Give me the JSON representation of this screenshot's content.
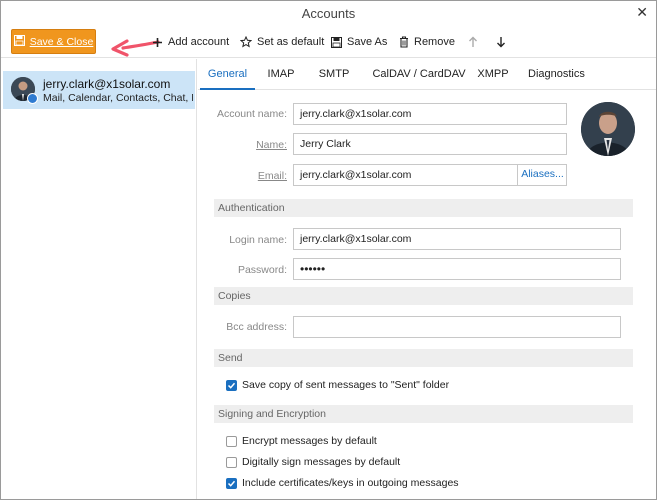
{
  "window": {
    "title": "Accounts"
  },
  "toolbar": {
    "save_close": "Save & Close",
    "add_account": "Add account",
    "set_default": "Set as default",
    "save_as": "Save As",
    "remove": "Remove"
  },
  "accounts": [
    {
      "email": "jerry.clark@x1solar.com",
      "description": "Mail, Calendar, Contacts, Chat, Not..."
    }
  ],
  "tabs": [
    {
      "label": "General",
      "active": true
    },
    {
      "label": "IMAP"
    },
    {
      "label": "SMTP"
    },
    {
      "label": "CalDAV / CardDAV"
    },
    {
      "label": "XMPP"
    },
    {
      "label": "Diagnostics"
    }
  ],
  "general": {
    "account_name_label": "Account name:",
    "account_name": "jerry.clark@x1solar.com",
    "name_label": "Name:",
    "name": "Jerry Clark",
    "email_label": "Email:",
    "email": "jerry.clark@x1solar.com",
    "aliases_button": "Aliases..."
  },
  "authentication": {
    "header": "Authentication",
    "login_label": "Login name:",
    "login": "jerry.clark@x1solar.com",
    "password_label": "Password:",
    "password": "••••••"
  },
  "copies": {
    "header": "Copies",
    "bcc_label": "Bcc address:",
    "bcc": ""
  },
  "send": {
    "header": "Send",
    "save_copy_label": "Save copy of sent messages to \"Sent\" folder",
    "save_copy_checked": true
  },
  "signing": {
    "header": "Signing and Encryption",
    "encrypt_label": "Encrypt messages by default",
    "encrypt_checked": false,
    "sign_label": "Digitally sign messages by default",
    "sign_checked": false,
    "include_certs_label": "Include certificates/keys in outgoing messages",
    "include_certs_checked": true
  },
  "colors": {
    "accent": "#1a6fc0",
    "save_button": "#f0961e",
    "selection": "#cce4f7",
    "annotation_arrow": "#f0546a"
  },
  "icons": [
    "close-icon",
    "save-icon",
    "plus-icon",
    "star-icon",
    "save-as-icon",
    "trash-icon",
    "arrow-up-icon",
    "arrow-down-icon",
    "checkmark-icon"
  ]
}
